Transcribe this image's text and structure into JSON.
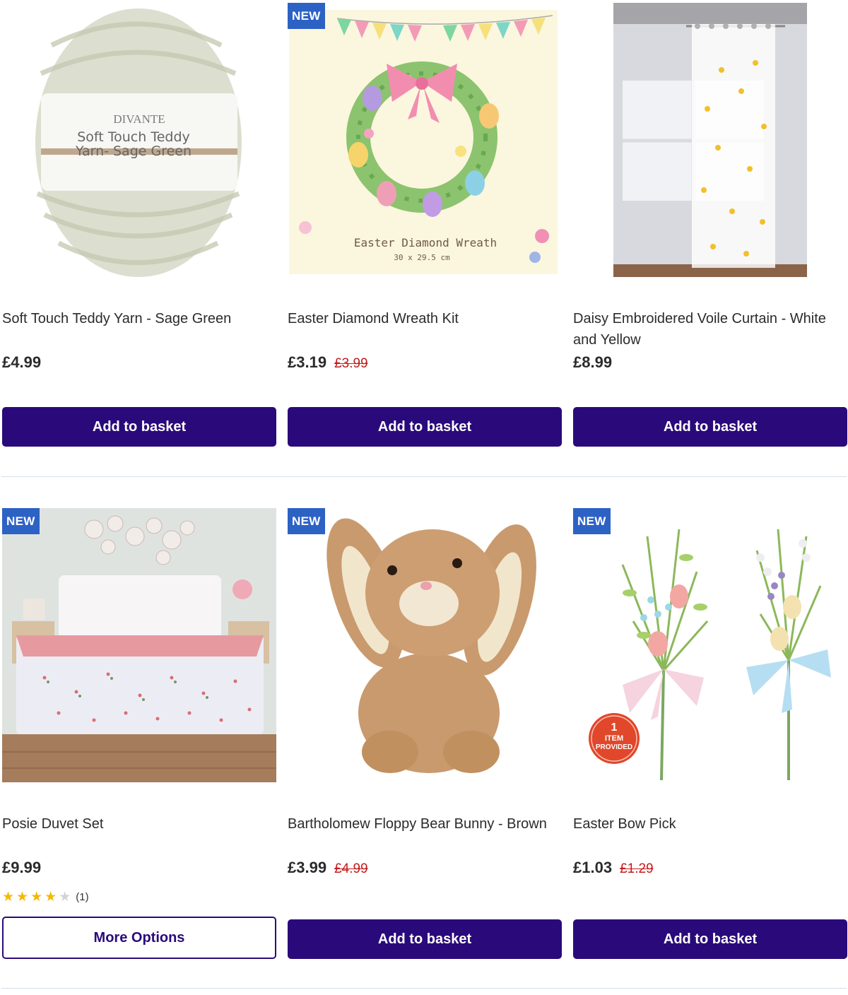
{
  "products": [
    {
      "title": "Soft Touch Teddy Yarn - Sage Green",
      "price": "£4.99",
      "button": "Add to basket"
    },
    {
      "badge": "NEW",
      "title": "Easter Diamond Wreath Kit",
      "price": "£3.19",
      "was_price": "£3.99",
      "button": "Add to basket"
    },
    {
      "title": "Daisy Embroidered Voile Curtain - White and Yellow",
      "price": "£8.99",
      "button": "Add to basket"
    },
    {
      "badge": "NEW",
      "title": "Posie Duvet Set",
      "price": "£9.99",
      "rating": {
        "value": 4,
        "max": 5,
        "count": "(1)"
      },
      "button": "More Options"
    },
    {
      "badge": "NEW",
      "title": "Bartholomew Floppy Bear Bunny - Brown",
      "price": "£3.99",
      "was_price": "£4.99",
      "button": "Add to basket"
    },
    {
      "badge": "NEW",
      "title": "Easter Bow Pick",
      "price": "£1.03",
      "was_price": "£1.29",
      "button": "Add to basket"
    }
  ],
  "image_text": {
    "yarn_brand": "DIVANTE",
    "yarn_line1": "Soft Touch Teddy",
    "yarn_line2": "Yarn- Sage Green",
    "wreath_caption": "Easter Diamond Wreath",
    "wreath_size": "30 x 29.5 cm",
    "pick_sticker_num": "1",
    "pick_sticker_line1": "ITEM",
    "pick_sticker_line2": "PROVIDED"
  },
  "colors": {
    "button_bg": "#2a0a7a",
    "badge_bg": "#2d62c5",
    "was_price": "#c21c1c",
    "star": "#f2b90a"
  }
}
